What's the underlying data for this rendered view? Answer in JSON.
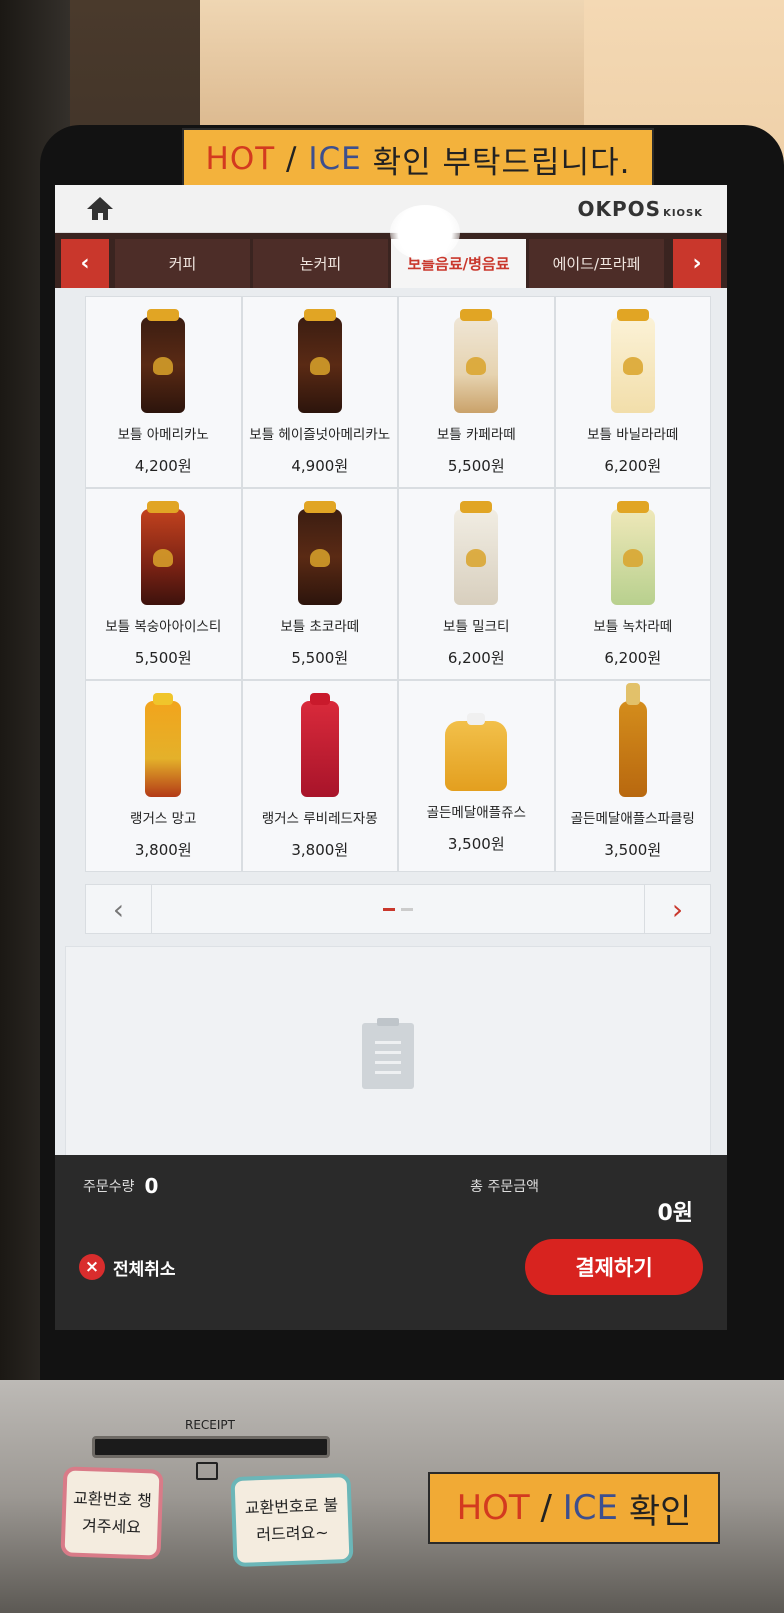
{
  "top_sign": {
    "hot": "HOT",
    "sep": "/",
    "ice": "ICE",
    "rest": "확인 부탁드립니다."
  },
  "header": {
    "brand": "OKPOS",
    "brand_sub": "KIOSK"
  },
  "tabs": [
    {
      "label": "커피"
    },
    {
      "label": "논커피"
    },
    {
      "label": "보틀음료/병음료"
    },
    {
      "label": "에이드/프라페"
    }
  ],
  "products": [
    {
      "name": "보틀 아메리카노",
      "price": "4,200원"
    },
    {
      "name": "보틀 헤이즐넛아메리카노",
      "price": "4,900원"
    },
    {
      "name": "보틀 카페라떼",
      "price": "5,500원"
    },
    {
      "name": "보틀 바닐라라떼",
      "price": "6,200원"
    },
    {
      "name": "보틀 복숭아아이스티",
      "price": "5,500원"
    },
    {
      "name": "보틀 초코라떼",
      "price": "5,500원"
    },
    {
      "name": "보틀 밀크티",
      "price": "6,200원"
    },
    {
      "name": "보틀 녹차라떼",
      "price": "6,200원"
    },
    {
      "name": "랭거스 망고",
      "price": "3,800원"
    },
    {
      "name": "랭거스 루비레드자몽",
      "price": "3,800원"
    },
    {
      "name": "골든메달애플쥬스",
      "price": "3,500원"
    },
    {
      "name": "골든메달애플스파클링",
      "price": "3,500원"
    }
  ],
  "summary": {
    "qty_label": "주문수량",
    "qty_value": "0",
    "total_label": "총 주문금액",
    "total_value": "0원"
  },
  "actions": {
    "cancel_all": "전체취소",
    "pay": "결제하기"
  },
  "hardware": {
    "receipt_label": "RECEIPT",
    "note_red": "교환번호 챙겨주세요",
    "note_teal": "교환번호로 불러드려요~",
    "bottom_sign": {
      "hot": "HOT",
      "sep": "/",
      "ice": "ICE",
      "rest": "확인"
    }
  },
  "colors": {
    "accent": "#c9372c",
    "pay": "#d8231f",
    "tab_bg": "#3a2420"
  },
  "icons": [
    "home-icon",
    "chevron-left-icon",
    "chevron-right-icon",
    "close-icon",
    "cart-empty-icon",
    "printer-icon"
  ]
}
